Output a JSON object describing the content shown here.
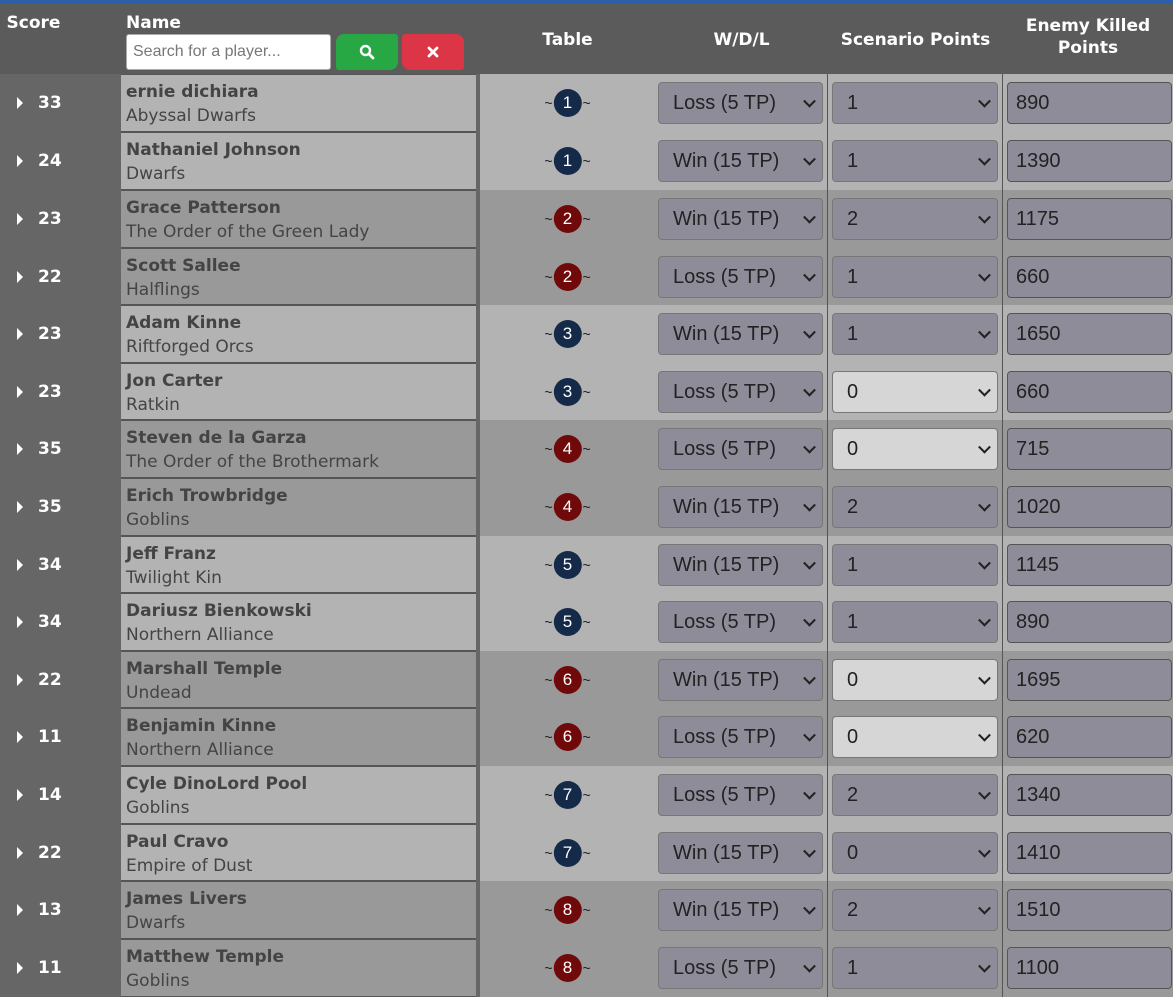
{
  "header": {
    "score": "Score",
    "name": "Name",
    "table": "Table",
    "wdl": "W/D/L",
    "scenario": "Scenario Points",
    "enemy_killed": "Enemy Killed Points",
    "search_placeholder": "Search for a player...",
    "search_icon": "search-icon",
    "clear_icon": "times-icon"
  },
  "colors": {
    "table_odd": "#152a48",
    "table_even": "#700a0a",
    "row_light": "#b3b3b3",
    "row_dark": "#999999",
    "select_bg": "#8e8c99",
    "select_light_bg": "#d6d6d6",
    "search_button": "#28a745",
    "clear_button": "#dc3545"
  },
  "rows": [
    {
      "score": "33",
      "name": "ernie dichiara",
      "army": "Abyssal Dwarfs",
      "table": "1",
      "wdl": "Loss (5 TP)",
      "scenario": "1",
      "killed": "890"
    },
    {
      "score": "24",
      "name": "Nathaniel Johnson",
      "army": "Dwarfs",
      "table": "1",
      "wdl": "Win (15 TP)",
      "scenario": "1",
      "killed": "1390"
    },
    {
      "score": "23",
      "name": "Grace Patterson",
      "army": "The Order of the Green Lady",
      "table": "2",
      "wdl": "Win (15 TP)",
      "scenario": "2",
      "killed": "1175"
    },
    {
      "score": "22",
      "name": "Scott Sallee",
      "army": "Halflings",
      "table": "2",
      "wdl": "Loss (5 TP)",
      "scenario": "1",
      "killed": "660"
    },
    {
      "score": "23",
      "name": "Adam Kinne",
      "army": "Riftforged Orcs",
      "table": "3",
      "wdl": "Win (15 TP)",
      "scenario": "1",
      "killed": "1650"
    },
    {
      "score": "23",
      "name": "Jon Carter",
      "army": "Ratkin",
      "table": "3",
      "wdl": "Loss (5 TP)",
      "scenario": "0",
      "killed": "660"
    },
    {
      "score": "35",
      "name": "Steven de la Garza",
      "army": "The Order of the Brothermark",
      "table": "4",
      "wdl": "Loss (5 TP)",
      "scenario": "0",
      "killed": "715"
    },
    {
      "score": "35",
      "name": "Erich Trowbridge",
      "army": "Goblins",
      "table": "4",
      "wdl": "Win (15 TP)",
      "scenario": "2",
      "killed": "1020"
    },
    {
      "score": "34",
      "name": "Jeff Franz",
      "army": "Twilight Kin",
      "table": "5",
      "wdl": "Win (15 TP)",
      "scenario": "1",
      "killed": "1145"
    },
    {
      "score": "34",
      "name": "Dariusz Bienkowski",
      "army": "Northern Alliance",
      "table": "5",
      "wdl": "Loss (5 TP)",
      "scenario": "1",
      "killed": "890"
    },
    {
      "score": "22",
      "name": "Marshall Temple",
      "army": "Undead",
      "table": "6",
      "wdl": "Win (15 TP)",
      "scenario": "0",
      "killed": "1695"
    },
    {
      "score": "11",
      "name": "Benjamin Kinne",
      "army": "Northern Alliance",
      "table": "6",
      "wdl": "Loss (5 TP)",
      "scenario": "0",
      "killed": "620"
    },
    {
      "score": "14",
      "name": "Cyle DinoLord Pool",
      "army": "Goblins",
      "table": "7",
      "wdl": "Loss (5 TP)",
      "scenario": "2",
      "killed": "1340"
    },
    {
      "score": "22",
      "name": "Paul Cravo",
      "army": "Empire of Dust",
      "table": "7",
      "wdl": "Win (15 TP)",
      "scenario": "0",
      "killed": "1410"
    },
    {
      "score": "13",
      "name": "James Livers",
      "army": "Dwarfs",
      "table": "8",
      "wdl": "Win (15 TP)",
      "scenario": "2",
      "killed": "1510"
    },
    {
      "score": "11",
      "name": "Matthew Temple",
      "army": "Goblins",
      "table": "8",
      "wdl": "Loss (5 TP)",
      "scenario": "1",
      "killed": "1100"
    }
  ]
}
